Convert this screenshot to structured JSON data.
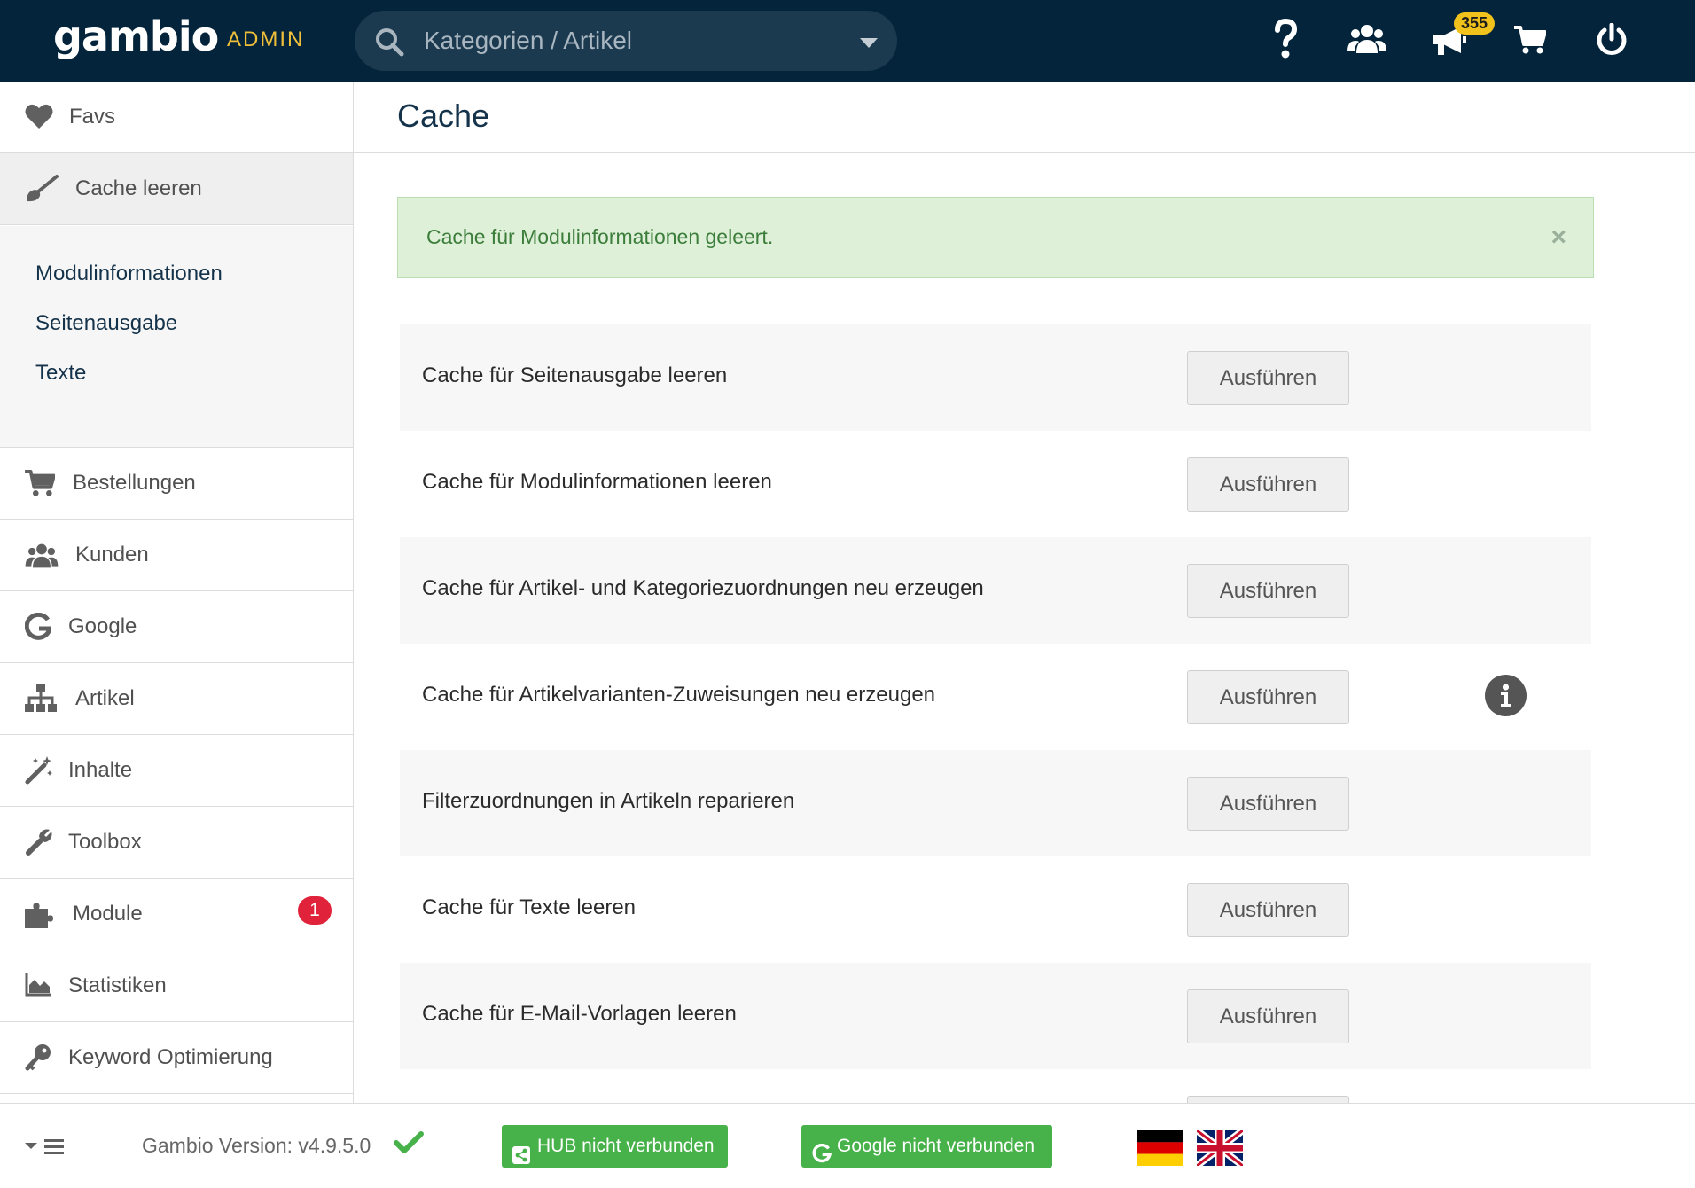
{
  "header": {
    "logo": "gambio",
    "admin_label": "ADMIN",
    "search_placeholder": "Kategorien / Artikel",
    "icons": [
      "help-icon",
      "users-icon",
      "megaphone-icon",
      "cart-icon",
      "power-icon"
    ],
    "notification_count": "355"
  },
  "sidebar": {
    "favs": "Favs",
    "cache": "Cache leeren",
    "submenu": [
      "Modulinformationen",
      "Seitenausgabe",
      "Texte"
    ],
    "items": [
      {
        "label": "Bestellungen",
        "icon": "cart-icon"
      },
      {
        "label": "Kunden",
        "icon": "users-icon"
      },
      {
        "label": "Google",
        "icon": "google-icon"
      },
      {
        "label": "Artikel",
        "icon": "sitemap-icon"
      },
      {
        "label": "Inhalte",
        "icon": "magic-wand-icon"
      },
      {
        "label": "Toolbox",
        "icon": "wrench-icon"
      },
      {
        "label": "Module",
        "icon": "puzzle-icon",
        "badge": "1"
      },
      {
        "label": "Statistiken",
        "icon": "area-chart-icon"
      },
      {
        "label": "Keyword Optimierung",
        "icon": "key-icon"
      }
    ]
  },
  "main": {
    "title": "Cache",
    "alert": "Cache für Modulinformationen geleert.",
    "alert_close": "×",
    "rows": [
      {
        "label": "Cache für Seitenausgabe leeren",
        "button": "Ausführen"
      },
      {
        "label": "Cache für Modulinformationen leeren",
        "button": "Ausführen"
      },
      {
        "label": "Cache für Artikel- und Kategoriezuordnungen neu erzeugen",
        "button": "Ausführen"
      },
      {
        "label": "Cache für Artikelvarianten-Zuweisungen neu erzeugen",
        "button": "Ausführen"
      },
      {
        "label": "Filterzuordnungen in Artikeln reparieren",
        "button": "Ausführen"
      },
      {
        "label": "Cache für Texte leeren",
        "button": "Ausführen"
      },
      {
        "label": "Cache für E-Mail-Vorlagen leeren",
        "button": "Ausführen"
      }
    ]
  },
  "footer": {
    "version": "Gambio Version: v4.9.5.0",
    "hub": "HUB nicht verbunden",
    "google": "Google nicht verbunden",
    "languages": [
      "german-flag",
      "uk-flag"
    ]
  },
  "colors": {
    "topbar": "#03243a",
    "accent": "#f0bf3a",
    "success": "#47b14a",
    "badge": "#e0233a"
  }
}
